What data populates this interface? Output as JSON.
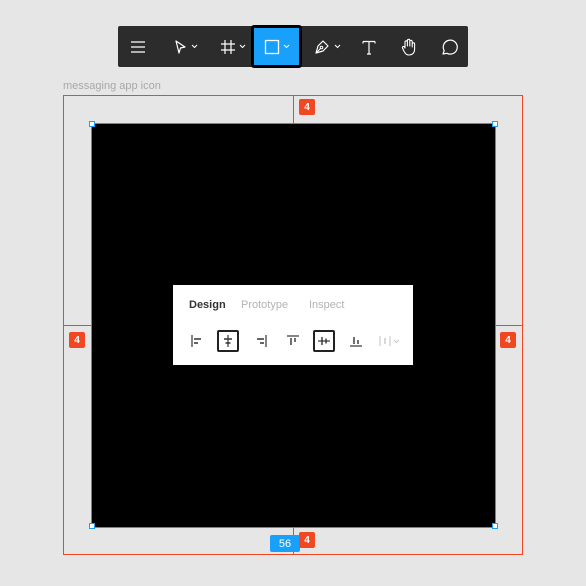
{
  "toolbar": {
    "tools": [
      {
        "name": "menu",
        "icon": "hamburger-menu-icon",
        "active": false
      },
      {
        "name": "move",
        "icon": "cursor-arrow-icon",
        "dropdown": true,
        "active": false
      },
      {
        "name": "frame",
        "icon": "frame-hash-icon",
        "dropdown": true,
        "active": false
      },
      {
        "name": "shape",
        "icon": "rectangle-icon",
        "dropdown": true,
        "active": true
      },
      {
        "name": "pen",
        "icon": "pen-icon",
        "dropdown": true,
        "active": false
      },
      {
        "name": "text",
        "icon": "text-t-icon",
        "active": false
      },
      {
        "name": "hand",
        "icon": "hand-icon",
        "active": false
      },
      {
        "name": "comment",
        "icon": "comment-bubble-icon",
        "active": false
      }
    ],
    "active_color": "#18a0fb"
  },
  "canvas": {
    "frame_label": "messaging app icon",
    "spacing": {
      "top": "4",
      "left": "4",
      "right": "4",
      "bottom": "4"
    },
    "size_readout": "56",
    "rect_fill": "#000000",
    "guide_color": "#f24822",
    "selection_color": "#18a0fb"
  },
  "panel": {
    "tabs": [
      {
        "label": "Design",
        "active": true
      },
      {
        "label": "Prototype",
        "active": false
      },
      {
        "label": "Inspect",
        "active": false
      }
    ],
    "align_buttons": [
      {
        "icon": "align-left-icon",
        "selected": false
      },
      {
        "icon": "align-horizontal-center-icon",
        "selected": true
      },
      {
        "icon": "align-right-icon",
        "selected": false
      },
      {
        "icon": "align-top-icon",
        "selected": false
      },
      {
        "icon": "align-vertical-center-icon",
        "selected": true
      },
      {
        "icon": "align-bottom-icon",
        "selected": false
      },
      {
        "icon": "distribute-spacing-icon",
        "selected": false,
        "disabled": true
      }
    ]
  }
}
